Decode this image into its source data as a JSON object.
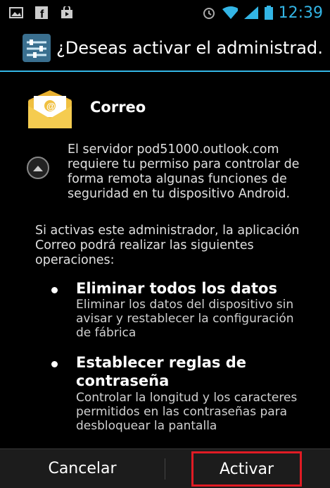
{
  "status_bar": {
    "time": "12:39",
    "time_color": "#33b5e5",
    "left_icons": [
      "image-icon",
      "facebook-icon",
      "shopping-bag-icon"
    ],
    "right_icons": [
      "alarm-icon",
      "wifi-icon",
      "signal-icon",
      "battery-icon"
    ]
  },
  "title_bar": {
    "title": "¿Deseas activar el administrad…",
    "accent_color": "#33b5e5"
  },
  "app": {
    "name": "Correo"
  },
  "server_text": "El servidor pod51000.outlook.com requiere tu permiso para controlar de forma remota algunas funciones de seguridad en tu dispositivo Android.",
  "intro_text": "Si activas este administrador, la aplicación Correo podrá realizar las siguientes operaciones:",
  "permissions": [
    {
      "title": "Eliminar todos los datos",
      "description": "Eliminar los datos del dispositivo sin avisar y restablecer la configuración de fábrica"
    },
    {
      "title": "Establecer reglas de contraseña",
      "description": "Controlar la longitud y los caracteres permitidos en las contraseñas para desbloquear la pantalla"
    }
  ],
  "buttons": {
    "cancel": "Cancelar",
    "activate": "Activar"
  },
  "highlight_color": "#e01b24"
}
